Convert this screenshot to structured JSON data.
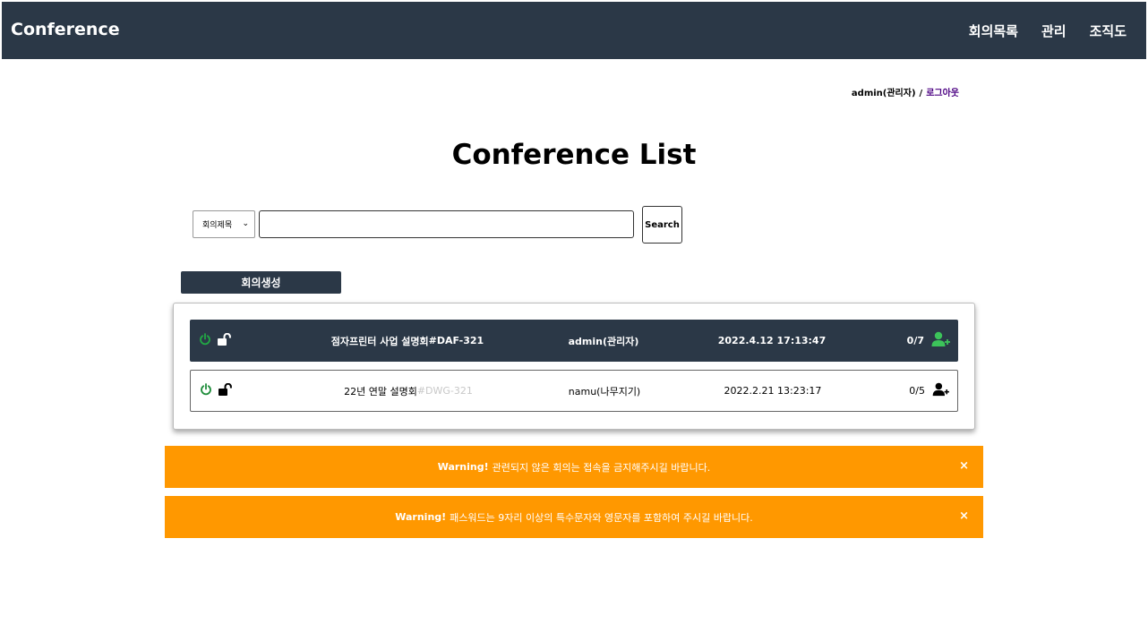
{
  "navbar": {
    "brand": "Conference",
    "links": [
      "회의목록",
      "관리",
      "조직도"
    ]
  },
  "user": {
    "name": "admin(관리자)",
    "separator": "/",
    "logout": "로그아웃"
  },
  "page_title": "Conference List",
  "search": {
    "select_value": "회의제목",
    "input_value": "",
    "button_label": "Search"
  },
  "create_button": "회의생성",
  "conferences": [
    {
      "title": "점자프린터 사업 설명회",
      "code": "#DAF-321",
      "host": "admin(관리자)",
      "date": "2022.4.12 17:13:47",
      "count": "0/7",
      "colors": {
        "power": "#22a845",
        "add_user": "#3cc35a"
      }
    },
    {
      "title": "22년 연말 설명회",
      "code": "#DWG-321",
      "host": "namu(나무지기)",
      "date": "2022.2.21 13:23:17",
      "count": "0/5",
      "colors": {
        "power": "#1e8c3a",
        "add_user": "#000000"
      }
    }
  ],
  "alerts": [
    {
      "prefix": "Warning!",
      "message": "관련되지 않은 회의는 접속을 금지해주시길 바랍니다.",
      "close": "×"
    },
    {
      "prefix": "Warning!",
      "message": "패스워드는 9자리 이상의 특수문자와 영문자를 포함하여 주시길 바랍니다.",
      "close": "×"
    }
  ],
  "icons": {
    "status": "power-icon",
    "lock": "unlock-icon",
    "participants": "user-plus-icon"
  },
  "colors": {
    "navbar": "#2b3847",
    "alert": "#ff9800",
    "logout_link": "#4b0082"
  }
}
